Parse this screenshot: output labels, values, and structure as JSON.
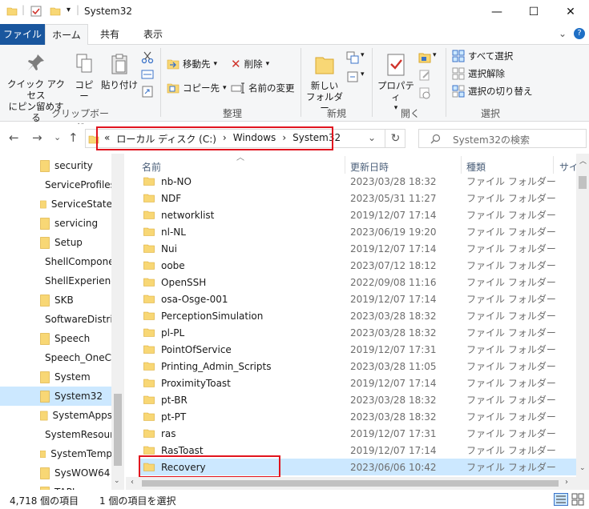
{
  "window": {
    "title": "System32",
    "minimize": "—",
    "maximize": "☐",
    "close": "✕"
  },
  "colors": {
    "accent": "#19569e",
    "selection": "#cce8ff",
    "highlight": "#e1141e",
    "folder": "#f8d775"
  },
  "ribbon": {
    "tabs": [
      "ファイル",
      "ホーム",
      "共有",
      "表示"
    ],
    "clipboard": {
      "pin": "クイック アクセス\nにピン留めする",
      "copy": "コピー",
      "paste": "貼り付け",
      "label": "クリップボード"
    },
    "organize": {
      "move_to": "移動先",
      "copy_to": "コピー先",
      "delete": "削除",
      "rename": "名前の変更",
      "label": "整理"
    },
    "new": {
      "new_folder": "新しい\nフォルダー",
      "label": "新規"
    },
    "open": {
      "properties": "プロパティ",
      "label": "開く"
    },
    "select": {
      "select_all": "すべて選択",
      "select_none": "選択解除",
      "invert": "選択の切り替え",
      "label": "選択"
    }
  },
  "nav": {
    "back": "←",
    "forward": "→",
    "recent": "⌄",
    "up": "↑",
    "breadcrumb": [
      "«",
      "ローカル ディスク (C:)",
      "›",
      "Windows",
      "›",
      "System32"
    ],
    "dropdown": "⌄",
    "refresh": "↻",
    "search_placeholder": "System32の検索"
  },
  "left_pane": {
    "items": [
      "security",
      "ServiceProfiles",
      "ServiceState",
      "servicing",
      "Setup",
      "ShellComponents",
      "ShellExperiences",
      "SKB",
      "SoftwareDistribution",
      "Speech",
      "Speech_OneCore",
      "System",
      "System32",
      "SystemApps",
      "SystemResources",
      "SystemTemp",
      "SysWOW64",
      "TAPI"
    ],
    "selected": "System32"
  },
  "file_list": {
    "columns": [
      "名前",
      "更新日時",
      "種類",
      "サイズ"
    ],
    "rows": [
      {
        "name": "nb-NO",
        "date": "2023/03/28 18:32",
        "type": "ファイル フォルダー"
      },
      {
        "name": "NDF",
        "date": "2023/05/31 11:27",
        "type": "ファイル フォルダー"
      },
      {
        "name": "networklist",
        "date": "2019/12/07 17:14",
        "type": "ファイル フォルダー"
      },
      {
        "name": "nl-NL",
        "date": "2023/06/19 19:20",
        "type": "ファイル フォルダー"
      },
      {
        "name": "Nui",
        "date": "2019/12/07 17:14",
        "type": "ファイル フォルダー"
      },
      {
        "name": "oobe",
        "date": "2023/07/12 18:12",
        "type": "ファイル フォルダー"
      },
      {
        "name": "OpenSSH",
        "date": "2022/09/08 11:16",
        "type": "ファイル フォルダー"
      },
      {
        "name": "osa-Osge-001",
        "date": "2019/12/07 17:14",
        "type": "ファイル フォルダー"
      },
      {
        "name": "PerceptionSimulation",
        "date": "2023/03/28 18:32",
        "type": "ファイル フォルダー"
      },
      {
        "name": "pl-PL",
        "date": "2023/03/28 18:32",
        "type": "ファイル フォルダー"
      },
      {
        "name": "PointOfService",
        "date": "2019/12/07 17:31",
        "type": "ファイル フォルダー"
      },
      {
        "name": "Printing_Admin_Scripts",
        "date": "2023/03/28 11:05",
        "type": "ファイル フォルダー"
      },
      {
        "name": "ProximityToast",
        "date": "2019/12/07 17:14",
        "type": "ファイル フォルダー"
      },
      {
        "name": "pt-BR",
        "date": "2023/03/28 18:32",
        "type": "ファイル フォルダー"
      },
      {
        "name": "pt-PT",
        "date": "2023/03/28 18:32",
        "type": "ファイル フォルダー"
      },
      {
        "name": "ras",
        "date": "2019/12/07 17:31",
        "type": "ファイル フォルダー"
      },
      {
        "name": "RasToast",
        "date": "2019/12/07 17:14",
        "type": "ファイル フォルダー"
      },
      {
        "name": "Recovery",
        "date": "2023/06/06 10:42",
        "type": "ファイル フォルダー"
      }
    ],
    "selected": "Recovery"
  },
  "status": {
    "count": "4,718 個の項目",
    "selected": "1 個の項目を選択"
  }
}
